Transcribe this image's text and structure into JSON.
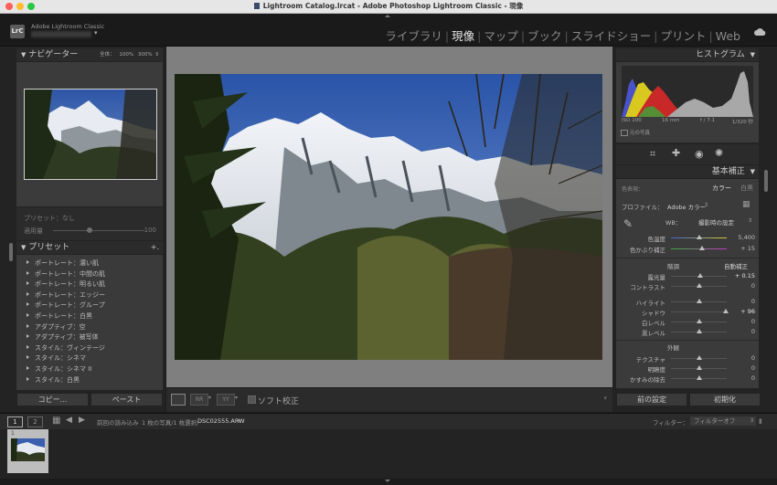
{
  "window": {
    "title": "Lightroom Catalog.lrcat - Adobe Photoshop Lightroom Classic - 現像"
  },
  "identity": {
    "logo": "LrC",
    "app_name": "Adobe Lightroom Classic"
  },
  "modules": [
    "ライブラリ",
    "現像",
    "マップ",
    "ブック",
    "スライドショー",
    "プリント",
    "Web"
  ],
  "active_module": "現像",
  "left": {
    "navigator": {
      "title": "ナビゲーター",
      "zoom_options": [
        "全体：",
        "100%",
        "300%"
      ]
    },
    "preset_amount": {
      "label": "プリセット：なし",
      "amount_label": "適用量",
      "amount_value": "100"
    },
    "presets": {
      "title": "プリセット",
      "add": "+.",
      "items": [
        "ポートレート：濃い肌",
        "ポートレート：中間の肌",
        "ポートレート：明るい肌",
        "ポートレート：エッジー",
        "ポートレート：グループ",
        "ポートレート：白黒",
        "アダプティブ：空",
        "アダプティブ：被写体",
        "スタイル：ヴィンテージ",
        "スタイル：シネマ",
        "スタイル：シネマ II",
        "スタイル：白黒"
      ]
    },
    "copy": "コピー...",
    "paste": "ペースト"
  },
  "toolbar": {
    "soft_proof": "ソフト校正"
  },
  "right": {
    "histogram": {
      "title": "ヒストグラム",
      "iso": "ISO 100",
      "focal": "16 mm",
      "aperture": "f / 7.1",
      "shutter": "1/320 秒",
      "original": "元の写真"
    },
    "basic": {
      "title": "基本補正",
      "treatment_label": "色表現：",
      "treatment_color": "カラー",
      "treatment_bw": "白黒",
      "profile_label": "プロファイル：",
      "profile_value": "Adobe カラー",
      "wb_label": "WB：",
      "wb_value": "撮影時の設定",
      "temp_label": "色温度",
      "temp_value": "5,400",
      "tint_label": "色かぶり補正",
      "tint_value": "+ 15",
      "tone_label": "階調",
      "auto_label": "自動補正",
      "exposure_label": "露光量",
      "exposure_value": "+ 0.15",
      "contrast_label": "コントラスト",
      "contrast_value": "0",
      "highlights_label": "ハイライト",
      "highlights_value": "0",
      "shadows_label": "シャドウ",
      "shadows_value": "+ 96",
      "whites_label": "白レベル",
      "whites_value": "0",
      "blacks_label": "黒レベル",
      "blacks_value": "0",
      "presence_label": "外観",
      "texture_label": "テクスチャ",
      "texture_value": "0",
      "clarity_label": "明瞭度",
      "clarity_value": "0",
      "dehaze_label": "かすみの除去",
      "dehaze_value": "0"
    },
    "previous": "前の設定",
    "reset": "初期化"
  },
  "filmstrip": {
    "view1": "1",
    "view2": "2",
    "source": "前回の読み込み",
    "count": "1 枚の写真/1 枚選択/",
    "filename": "DSC02555.ARW",
    "filter_label": "フィルター：",
    "filter_value": "フィルターオフ",
    "thumb_index": "1"
  },
  "colors": {
    "accent": "#e8e8e8",
    "panel": "#2b2b2b",
    "background": "#1b1b1b"
  },
  "slider_levels": {
    "amount": 100,
    "temp": 0.5,
    "tint": 0.55,
    "exposure": 0.52,
    "contrast": 0.5,
    "highlights": 0.5,
    "shadows": 0.98,
    "whites": 0.5,
    "blacks": 0.5,
    "texture": 0.5,
    "clarity": 0.5,
    "dehaze": 0.5
  }
}
